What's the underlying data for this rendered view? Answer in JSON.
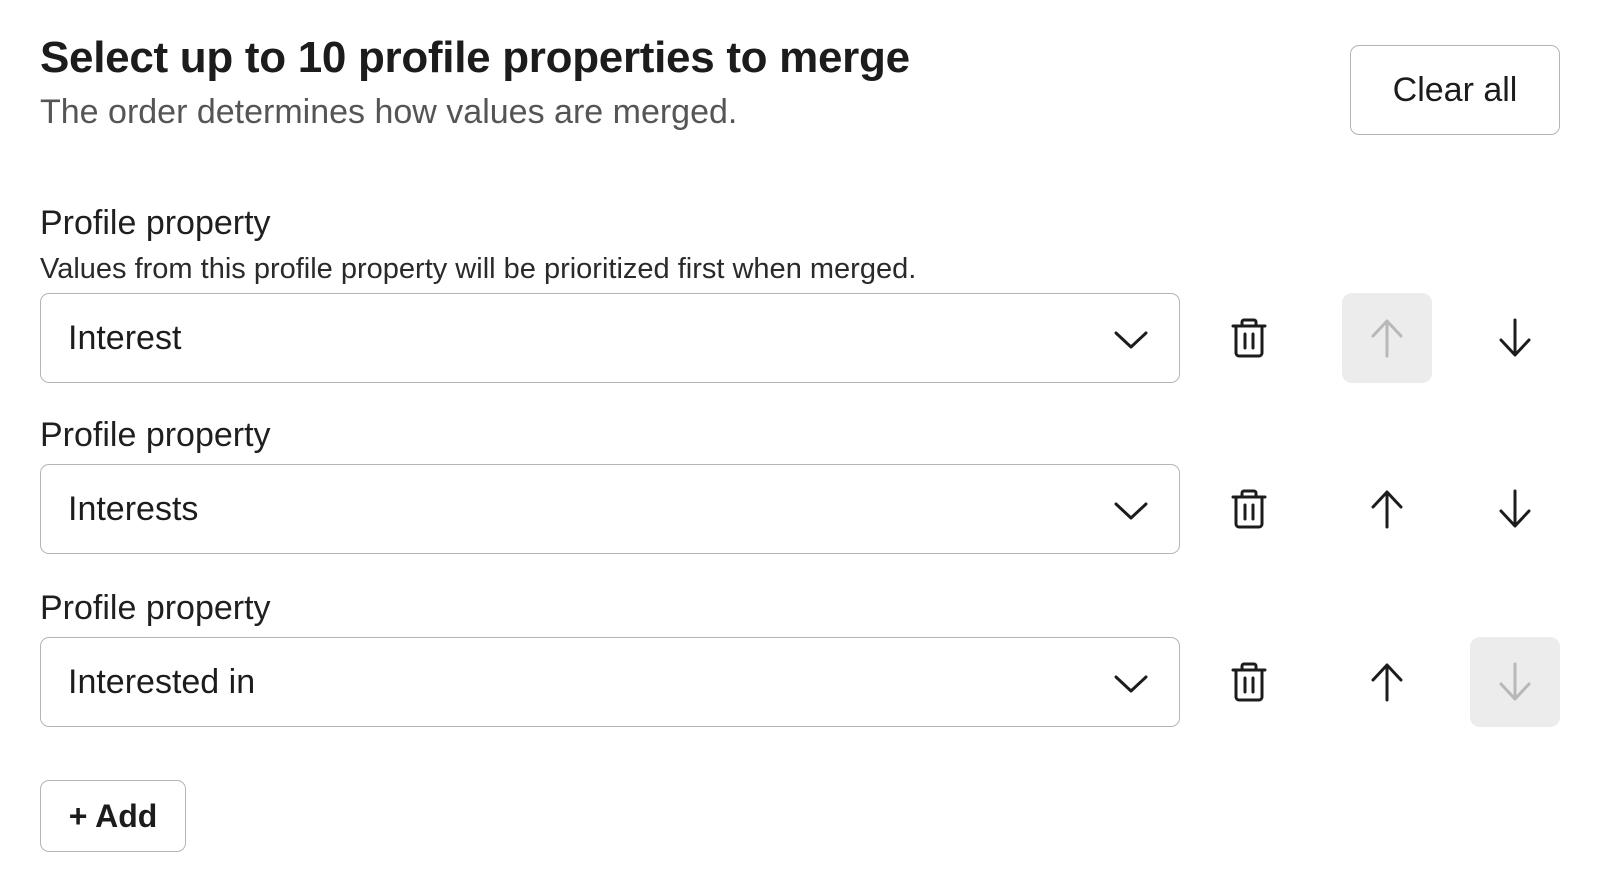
{
  "header": {
    "title": "Select up to 10 profile properties to merge",
    "subtitle": "The order determines how values are merged."
  },
  "actions": {
    "clear_all_label": "Clear all",
    "add_label": "+ Add"
  },
  "rows": [
    {
      "label": "Profile property",
      "help": "Values from this profile property will be prioritized first when merged.",
      "value": "Interest",
      "move_up_enabled": false,
      "move_down_enabled": true
    },
    {
      "label": "Profile property",
      "value": "Interests",
      "move_up_enabled": true,
      "move_down_enabled": true
    },
    {
      "label": "Profile property",
      "value": "Interested in",
      "move_up_enabled": true,
      "move_down_enabled": false
    }
  ],
  "icons": {
    "chevron": "chevron-down-icon",
    "delete": "trash-icon",
    "up": "arrow-up-icon",
    "down": "arrow-down-icon"
  },
  "colors": {
    "text": "#1c1c1c",
    "muted": "#555555",
    "border": "#b5b5b5",
    "disabled_bg": "#ececec",
    "disabled_icon": "#b8b8b8"
  }
}
